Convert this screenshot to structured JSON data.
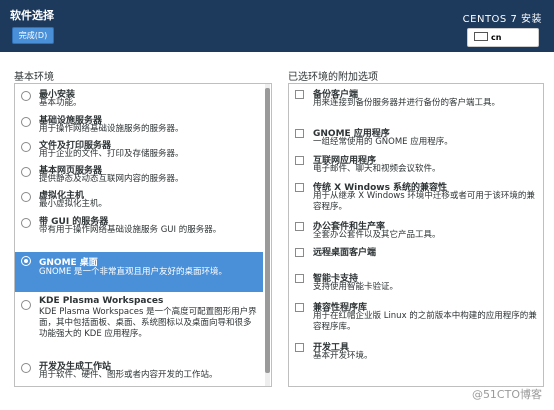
{
  "header": {
    "title": "软件选择",
    "done_label": "完成(D)",
    "product": "CENTOS 7 安装",
    "keyboard_layout": "cn"
  },
  "left": {
    "title": "基本环境",
    "items": [
      {
        "name": "最小安装",
        "desc": "基本功能。"
      },
      {
        "name": "基础设施服务器",
        "desc": "用于操作网络基础设施服务的服务器。"
      },
      {
        "name": "文件及打印服务器",
        "desc": "用于企业的文件、打印及存储服务器。"
      },
      {
        "name": "基本网页服务器",
        "desc": "提供静态及动态互联网内容的服务器。"
      },
      {
        "name": "虚拟化主机",
        "desc": "最小虚拟化主机。"
      },
      {
        "name": "带 GUI 的服务器",
        "desc": "带有用于操作网络基础设施服务 GUI 的服务器。"
      },
      {
        "name": "GNOME 桌面",
        "desc": "GNOME 是一个非常直观且用户友好的桌面环境。",
        "selected": true
      },
      {
        "name": "KDE Plasma Workspaces",
        "desc": "KDE Plasma Workspaces 是一个高度可配置图形用户界面，其中包括面板、桌面、系统图标以及桌面向导和很多功能强大的 KDE 应用程序。"
      },
      {
        "name": "开发及生成工作站",
        "desc": "用于软件、硬件、图形或者内容开发的工作站。"
      }
    ]
  },
  "right": {
    "title": "已选环境的附加选项",
    "items": [
      {
        "name": "备份客户端",
        "desc": "用来连接到备份服务器并进行备份的客户端工具。"
      },
      {
        "name": "GNOME 应用程序",
        "desc": "一组经常使用的 GNOME 应用程序。"
      },
      {
        "name": "互联网应用程序",
        "desc": "电子邮件、聊天和视频会议软件。"
      },
      {
        "name": "传统 X Windows 系统的兼容性",
        "desc": "用于从继承 X Windows 环境中迁移或者可用于该环境的兼容程序。"
      },
      {
        "name": "办公套件和生产率",
        "desc": "全套办公套件以及其它产品工具。"
      },
      {
        "name": "远程桌面客户端",
        "desc": ""
      },
      {
        "name": "智能卡支持",
        "desc": "支持使用智能卡验证。"
      },
      {
        "name": "兼容性程序库",
        "desc": "用于在红帽企业版 Linux 的之前版本中构建的应用程序的兼容程序库。"
      },
      {
        "name": "开发工具",
        "desc": "基本开发环境。"
      }
    ]
  },
  "watermark": "@51CTO博客"
}
